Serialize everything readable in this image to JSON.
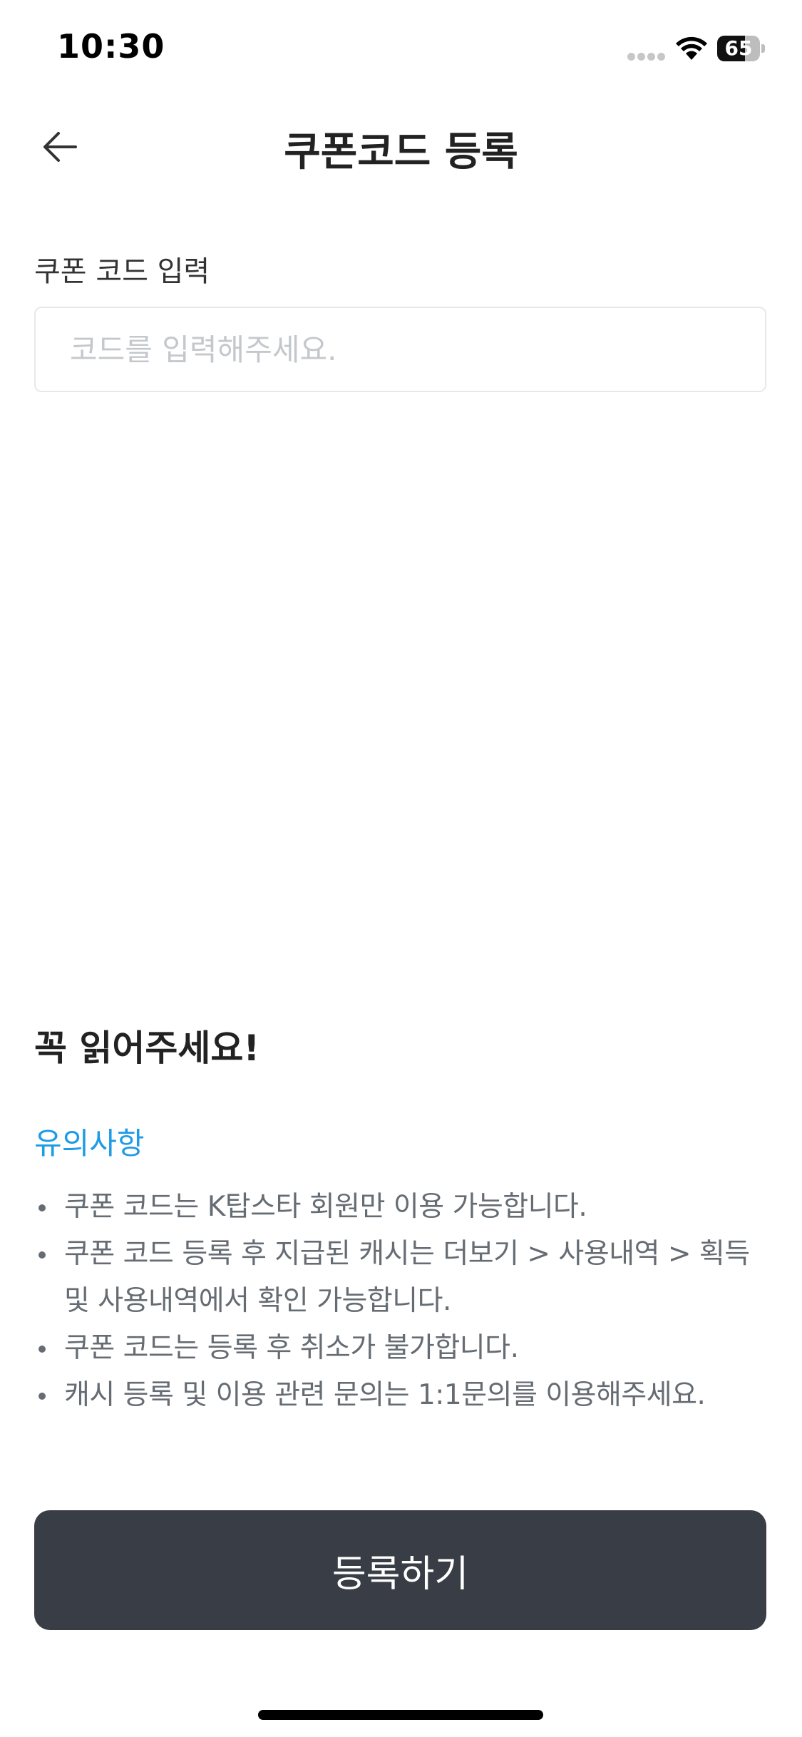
{
  "status_bar": {
    "time": "10:30",
    "battery_level": "65"
  },
  "header": {
    "title": "쿠폰코드 등록",
    "back_icon": "arrow-left-icon"
  },
  "coupon_input": {
    "label": "쿠폰 코드 입력",
    "placeholder": "코드를 입력해주세요.",
    "value": ""
  },
  "notice": {
    "title": "꼭 읽어주세요!",
    "subtitle": "유의사항",
    "subtitle_color": "#1e9be5",
    "items": [
      "쿠폰 코드는 K탑스타 회원만 이용 가능합니다.",
      "쿠폰 코드 등록 후 지급된 캐시는 더보기 > 사용내역 > 획득 및 사용내역에서 확인 가능합니다.",
      "쿠폰 코드는 등록 후 취소가 불가합니다.",
      "캐시 등록 및 이용 관련 문의는 1:1문의를 이용해주세요."
    ]
  },
  "register_button": {
    "label": "등록하기",
    "color": "#393d45"
  }
}
